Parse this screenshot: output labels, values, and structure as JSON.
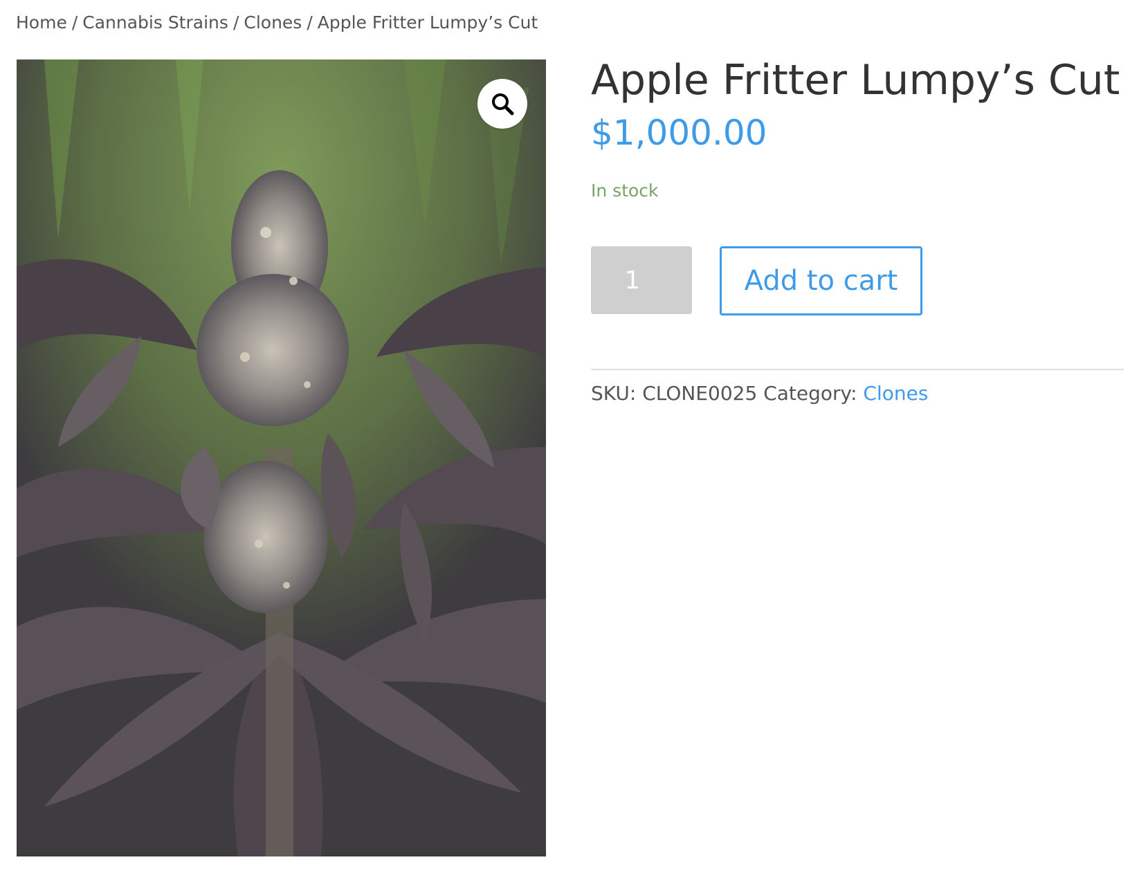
{
  "breadcrumb": {
    "items": [
      "Home",
      "Cannabis Strains",
      "Clones",
      "Apple Fritter Lumpy’s Cut"
    ],
    "separator": "/"
  },
  "gallery": {
    "zoom_icon": "magnifier-icon",
    "image_alt": "Apple Fritter Lumpy’s Cut"
  },
  "product": {
    "title": "Apple Fritter Lumpy’s Cut",
    "price": "$1,000.00",
    "stock_status": "In stock",
    "quantity": "1",
    "add_to_cart_label": "Add to cart",
    "sku_label": "SKU:",
    "sku_value": "CLONE0025",
    "category_label": "Category:",
    "category_value": "Clones"
  },
  "colors": {
    "accent": "#3d9be9",
    "in_stock": "#77a464",
    "text": "#333333",
    "muted_text": "#555555",
    "qty_bg": "#cfcfcf"
  }
}
